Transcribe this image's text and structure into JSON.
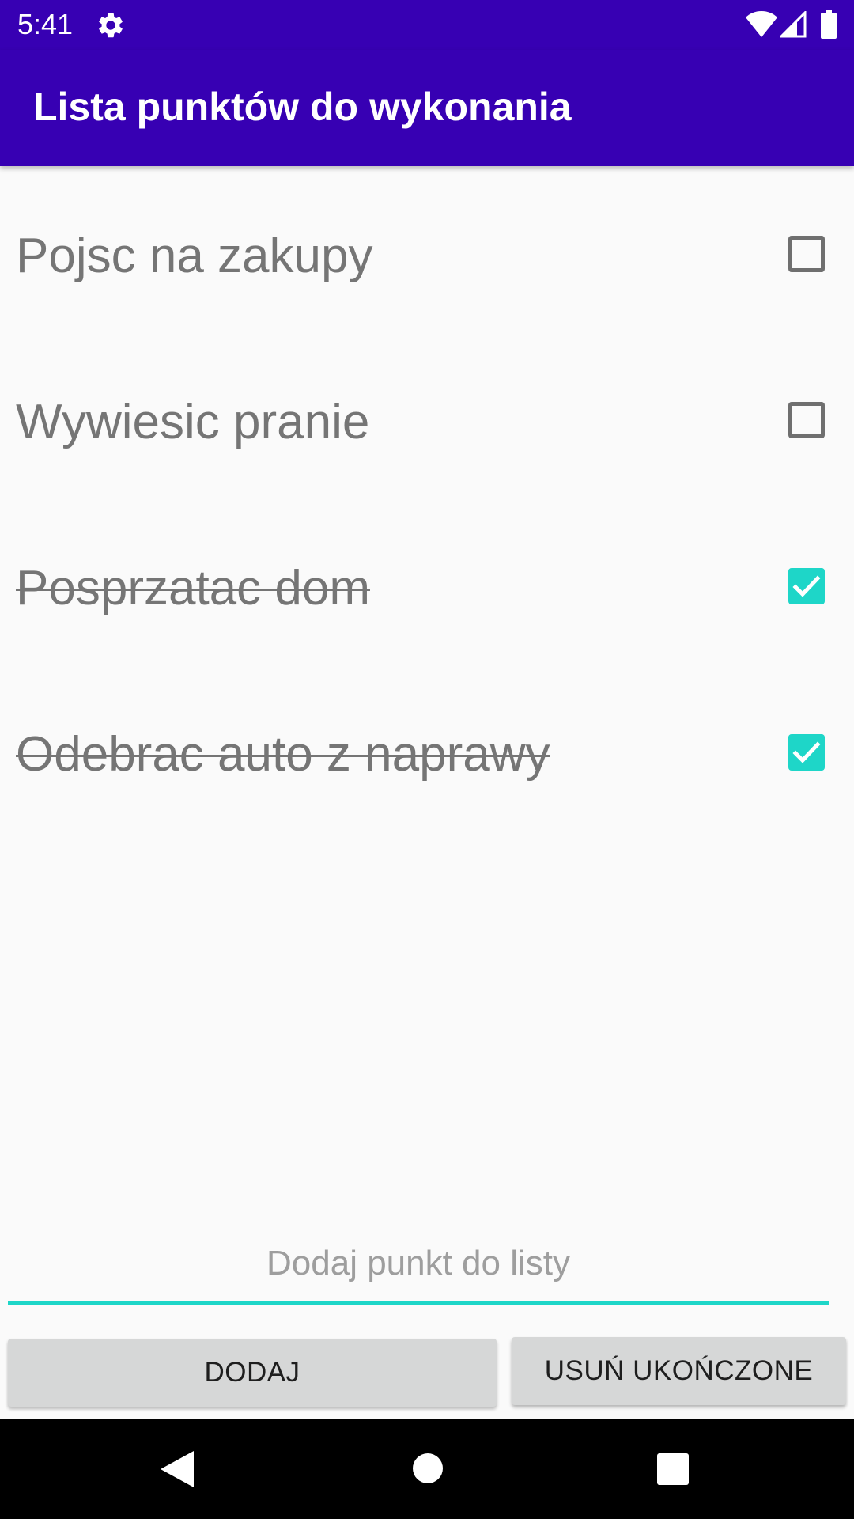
{
  "status_bar": {
    "time": "5:41",
    "icons": [
      "gear-icon",
      "wifi-icon",
      "cell-signal-icon",
      "battery-icon"
    ],
    "color": "#3700b3"
  },
  "app_bar": {
    "title": "Lista punktów do wykonania",
    "color": "#3700b3"
  },
  "todo_items": [
    {
      "label": "Pojsc na zakupy",
      "checked": false
    },
    {
      "label": "Wywiesic pranie",
      "checked": false
    },
    {
      "label": "Posprzatac dom",
      "checked": true
    },
    {
      "label": "Odebrac auto z naprawy",
      "checked": true
    }
  ],
  "add_input": {
    "placeholder": "Dodaj punkt do listy",
    "value": ""
  },
  "buttons": {
    "add_label": "DODAJ",
    "remove_completed_label": "USUŃ UKOŃCZONE"
  },
  "nav_bar": {
    "icons": [
      "back-icon",
      "home-icon",
      "recents-icon"
    ]
  },
  "colors": {
    "accent": "#1ed6c8",
    "primary_dark": "#3700b3",
    "item_text": "#757575",
    "button_bg": "#d6d7d7"
  }
}
